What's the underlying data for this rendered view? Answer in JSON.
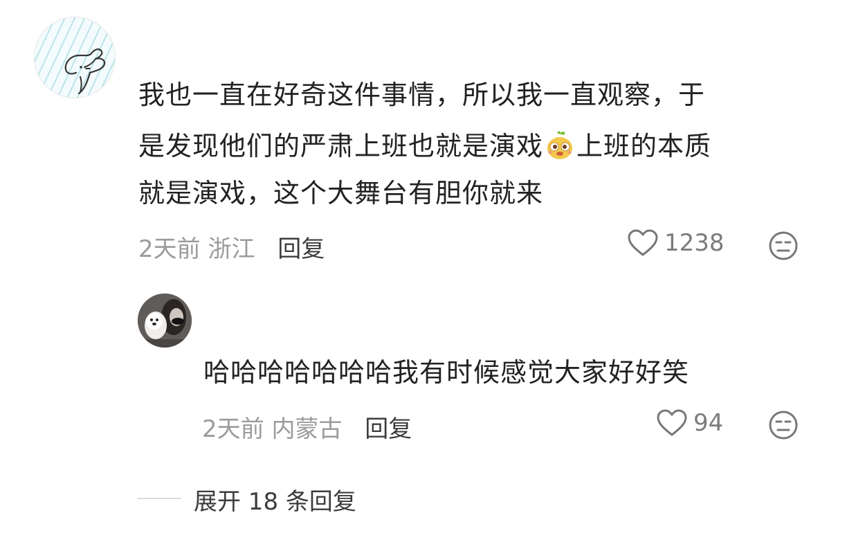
{
  "comment": {
    "text_line1": "我也一直在好奇这件事情，所以我一直观察，于",
    "text_line2a": "是发现他们的严肃上班也就是演戏",
    "text_line2b": "上班的本质",
    "text_line3": "就是演戏，这个大舞台有胆你就来",
    "inline_emoji": "smiling-face-emoji",
    "time": "2天前",
    "location": "浙江",
    "reply_label": "回复",
    "like_count": "1238"
  },
  "reply": {
    "text": "哈哈哈哈哈哈哈我有时候感觉大家好好笑",
    "time": "2天前",
    "location": "内蒙古",
    "reply_label": "回复",
    "like_count": "94"
  },
  "expand_replies_label": "展开 18 条回复",
  "colors": {
    "text_primary": "#222222",
    "text_meta": "#9b9b9b",
    "text_action": "#3c3c3c",
    "emoji_fill": "#f2c94c"
  }
}
